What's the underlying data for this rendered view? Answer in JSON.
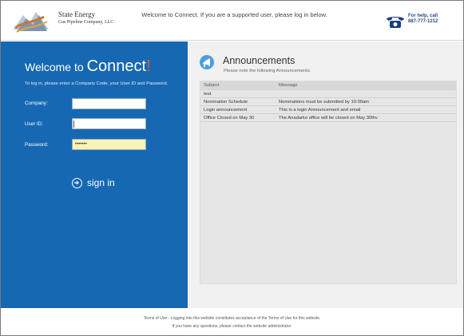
{
  "header": {
    "company_line1": "State Energy",
    "company_line2": "Gas Pipeline Company, LLC",
    "welcome_message": "Welcome to Connect. If you are a supported user, please log in below.",
    "help_line1": "For help, call",
    "help_line2": "887-777-1212"
  },
  "login": {
    "title_prefix": "Welcome to",
    "title_brand": "Connect",
    "title_bang": "!",
    "instructions": "To log in, please enter a Company Code, your User ID and Password.",
    "company_label": "Company:",
    "company_value": "",
    "userid_label": "User ID:",
    "userid_value": "",
    "password_label": "Password:",
    "password_value": "•••••••",
    "signin_label": "sign in"
  },
  "announcements": {
    "title": "Announcements",
    "subtitle": "Please note the following Announcements.",
    "columns": [
      "Subject",
      "Message"
    ],
    "rows": [
      {
        "subject": "test",
        "message": ""
      },
      {
        "subject": "Nomination Schedule",
        "message": "Nominations must be submitted by 10:00am"
      },
      {
        "subject": "Login announcement",
        "message": "This is a login Announcement and email"
      },
      {
        "subject": "Office Closed on May 30",
        "message": "The Anadarko office will be closed on May 30thv"
      }
    ]
  },
  "footer": {
    "line1": "Terms of Use - Logging into this website constitutes acceptance of the Terms of Use for this website.",
    "line2": "If you have any questions, please contact the website administrator."
  },
  "colors": {
    "panel_blue": "#1668b3",
    "accent_orange": "#e85c2c",
    "password_fill": "#faf3b4"
  }
}
